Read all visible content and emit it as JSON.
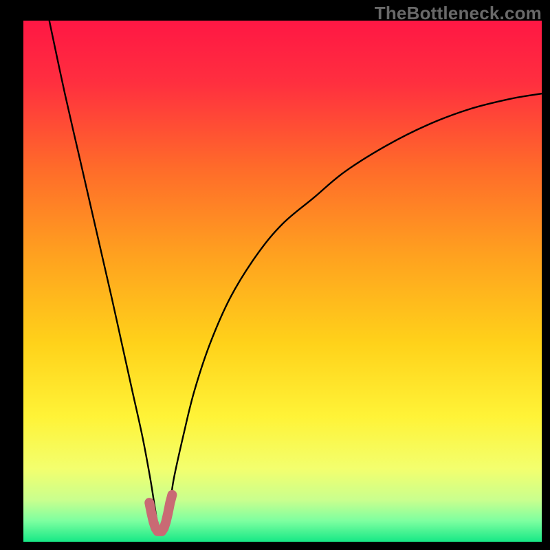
{
  "watermark": "TheBottleneck.com",
  "chart_data": {
    "type": "line",
    "title": "",
    "xlabel": "",
    "ylabel": "",
    "ylim": [
      0,
      100
    ],
    "xlim": [
      0,
      100
    ],
    "series": [
      {
        "name": "curve",
        "x": [
          5,
          8,
          11,
          14,
          17,
          19,
          21,
          23,
          24.5,
          25.3,
          26,
          26.7,
          27.5,
          28.3,
          29,
          31,
          33,
          36,
          40,
          45,
          50,
          56,
          62,
          70,
          78,
          86,
          94,
          100
        ],
        "y": [
          100,
          86,
          73,
          60,
          47,
          38,
          29,
          20,
          12,
          7,
          3,
          2,
          3,
          7,
          12,
          21,
          29,
          38,
          47,
          55,
          61,
          66,
          71,
          76,
          80,
          83,
          85,
          86
        ]
      },
      {
        "name": "bottom-marker",
        "x": [
          24.3,
          24.7,
          25.1,
          25.5,
          25.9,
          26.3,
          26.7,
          27.1,
          27.5,
          27.9,
          28.3,
          28.7
        ],
        "y": [
          7.5,
          5.5,
          3.8,
          2.6,
          2.0,
          2.0,
          2.0,
          2.6,
          3.8,
          5.5,
          7.5,
          9.0
        ]
      }
    ],
    "background_gradient_stops": [
      {
        "offset": 0.0,
        "color": "#ff1744"
      },
      {
        "offset": 0.12,
        "color": "#ff2f3f"
      },
      {
        "offset": 0.28,
        "color": "#ff6a2a"
      },
      {
        "offset": 0.45,
        "color": "#ffa11f"
      },
      {
        "offset": 0.62,
        "color": "#ffd21a"
      },
      {
        "offset": 0.76,
        "color": "#fff337"
      },
      {
        "offset": 0.86,
        "color": "#f3ff6e"
      },
      {
        "offset": 0.92,
        "color": "#c9ff8e"
      },
      {
        "offset": 0.96,
        "color": "#7dffa0"
      },
      {
        "offset": 1.0,
        "color": "#17e886"
      }
    ],
    "curve_stroke": "#000000",
    "marker_stroke": "#c96a74"
  }
}
